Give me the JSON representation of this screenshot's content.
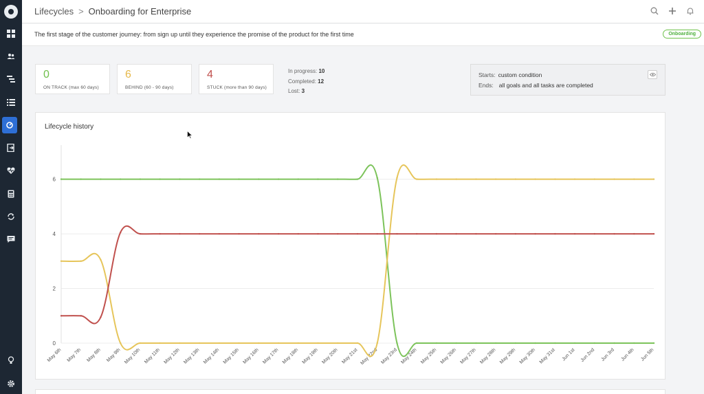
{
  "header": {
    "breadcrumb_parent": "Lifecycles",
    "breadcrumb_sep": ">",
    "title": "Onboarding for Enterprise"
  },
  "subheader": {
    "description": "The first stage of the customer journey: from sign up until they experience the promise of the product for the first time",
    "badge": "Onboarding"
  },
  "stats": [
    {
      "value": "0",
      "label": "ON TRACK (max 60 days)",
      "color": "#4caf3a"
    },
    {
      "value": "6",
      "label": "BEHIND (60 - 90 days)",
      "color": "#e6b84a"
    },
    {
      "value": "4",
      "label": "STUCK (more than 90 days)",
      "color": "#c0504d"
    }
  ],
  "counts": {
    "in_progress_label": "In progress:",
    "in_progress": "10",
    "completed_label": "Completed:",
    "completed": "12",
    "lost_label": "Lost:",
    "lost": "3"
  },
  "conditions": {
    "starts_label": "Starts:",
    "starts": "custom condition",
    "ends_label": "Ends:",
    "ends": "all goals and all tasks are completed"
  },
  "chart_title": "Lifecycle history",
  "icons": {
    "sidebar": [
      "dashboard-icon",
      "users-icon",
      "hierarchy-icon",
      "list-icon",
      "lifecycle-icon",
      "export-icon",
      "health-icon",
      "calculator-icon",
      "sync-icon",
      "chat-icon",
      "lightbulb-icon",
      "settings-icon"
    ],
    "top": [
      "search-icon",
      "plus-icon",
      "bell-icon"
    ]
  },
  "chart_data": {
    "type": "line",
    "x": [
      "May 6th",
      "May 7th",
      "May 8th",
      "May 9th",
      "May 10th",
      "May 11th",
      "May 12th",
      "May 13th",
      "May 14th",
      "May 15th",
      "May 16th",
      "May 17th",
      "May 18th",
      "May 19th",
      "May 20th",
      "May 21st",
      "May 22nd",
      "May 23rd",
      "May 24th",
      "May 25th",
      "May 26th",
      "May 27th",
      "May 28th",
      "May 29th",
      "May 30th",
      "May 31st",
      "Jun 1st",
      "Jun 2nd",
      "Jun 3rd",
      "Jun 4th",
      "Jun 5th"
    ],
    "yticks": [
      0,
      2,
      4,
      6
    ],
    "ylim": [
      0,
      7.5
    ],
    "series": [
      {
        "color": "#7cc35a",
        "values": [
          6,
          6,
          6,
          6,
          6,
          6,
          6,
          6,
          6,
          6,
          6,
          6,
          6,
          6,
          6,
          6,
          6.05,
          0,
          0,
          0,
          0,
          0,
          0,
          0,
          0,
          0,
          0,
          0,
          0,
          0,
          0
        ]
      },
      {
        "color": "#e6c55a",
        "values": [
          3,
          3,
          3.05,
          0,
          0,
          0,
          0,
          0,
          0,
          0,
          0,
          0,
          0,
          0,
          0,
          0,
          0,
          6.05,
          6,
          6,
          6,
          6,
          6,
          6,
          6,
          6,
          6,
          6,
          6,
          6,
          6
        ]
      },
      {
        "color": "#c0504d",
        "values": [
          1,
          1,
          0.95,
          4.05,
          4,
          4,
          4,
          4,
          4,
          4,
          4,
          4,
          4,
          4,
          4,
          4,
          4,
          4,
          4,
          4,
          4,
          4,
          4,
          4,
          4,
          4,
          4,
          4,
          4,
          4,
          4
        ]
      }
    ],
    "grid": true
  }
}
